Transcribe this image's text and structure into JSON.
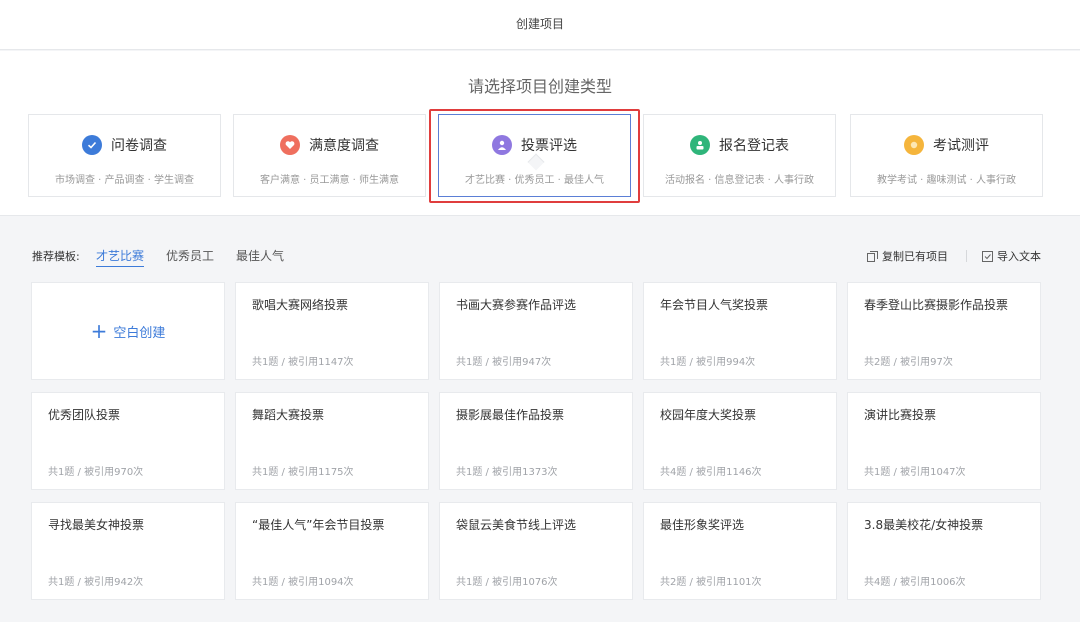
{
  "header": {
    "title": "创建项目"
  },
  "types": {
    "subtitle": "请选择项目创建类型",
    "items": [
      {
        "name": "问卷调查",
        "desc": "市场调查 · 产品调查 · 学生调查",
        "icon": "check-circle-icon",
        "color": "#3d7bd9"
      },
      {
        "name": "满意度调查",
        "desc": "客户满意 · 员工满意 · 师生满意",
        "icon": "heart-circle-icon",
        "color": "#ef6f5e"
      },
      {
        "name": "投票评选",
        "desc": "才艺比赛 · 优秀员工 · 最佳人气",
        "icon": "vote-person-icon",
        "color": "#8f78e0"
      },
      {
        "name": "报名登记表",
        "desc": "活动报名 · 信息登记表 · 人事行政",
        "icon": "register-person-icon",
        "color": "#2fb57a"
      },
      {
        "name": "考试测评",
        "desc": "教学考试 · 趣味测试 · 人事行政",
        "icon": "exam-icon",
        "color": "#f5b53c"
      }
    ]
  },
  "templates": {
    "label": "推荐模板:",
    "tabs": [
      "才艺比赛",
      "优秀员工",
      "最佳人气"
    ],
    "copy_label": "复制已有项目",
    "import_label": "导入文本",
    "blank_label": "空白创建",
    "cards": [
      {
        "title": "歌唱大赛网络投票",
        "meta": "共1题 / 被引用1147次"
      },
      {
        "title": "书画大赛参赛作品评选",
        "meta": "共1题 / 被引用947次"
      },
      {
        "title": "年会节目人气奖投票",
        "meta": "共1题 / 被引用994次"
      },
      {
        "title": "春季登山比赛摄影作品投票",
        "meta": "共2题 / 被引用97次"
      },
      {
        "title": "优秀团队投票",
        "meta": "共1题 / 被引用970次"
      },
      {
        "title": "舞蹈大赛投票",
        "meta": "共1题 / 被引用1175次"
      },
      {
        "title": "摄影展最佳作品投票",
        "meta": "共1题 / 被引用1373次"
      },
      {
        "title": "校园年度大奖投票",
        "meta": "共4题 / 被引用1146次"
      },
      {
        "title": "演讲比赛投票",
        "meta": "共1题 / 被引用1047次"
      },
      {
        "title": "寻找最美女神投票",
        "meta": "共1题 / 被引用942次"
      },
      {
        "title": "“最佳人气”年会节目投票",
        "meta": "共1题 / 被引用1094次"
      },
      {
        "title": "袋鼠云美食节线上评选",
        "meta": "共1题 / 被引用1076次"
      },
      {
        "title": "最佳形象奖评选",
        "meta": "共2题 / 被引用1101次"
      },
      {
        "title": "3.8最美校花/女神投票",
        "meta": "共4题 / 被引用1006次"
      }
    ]
  }
}
